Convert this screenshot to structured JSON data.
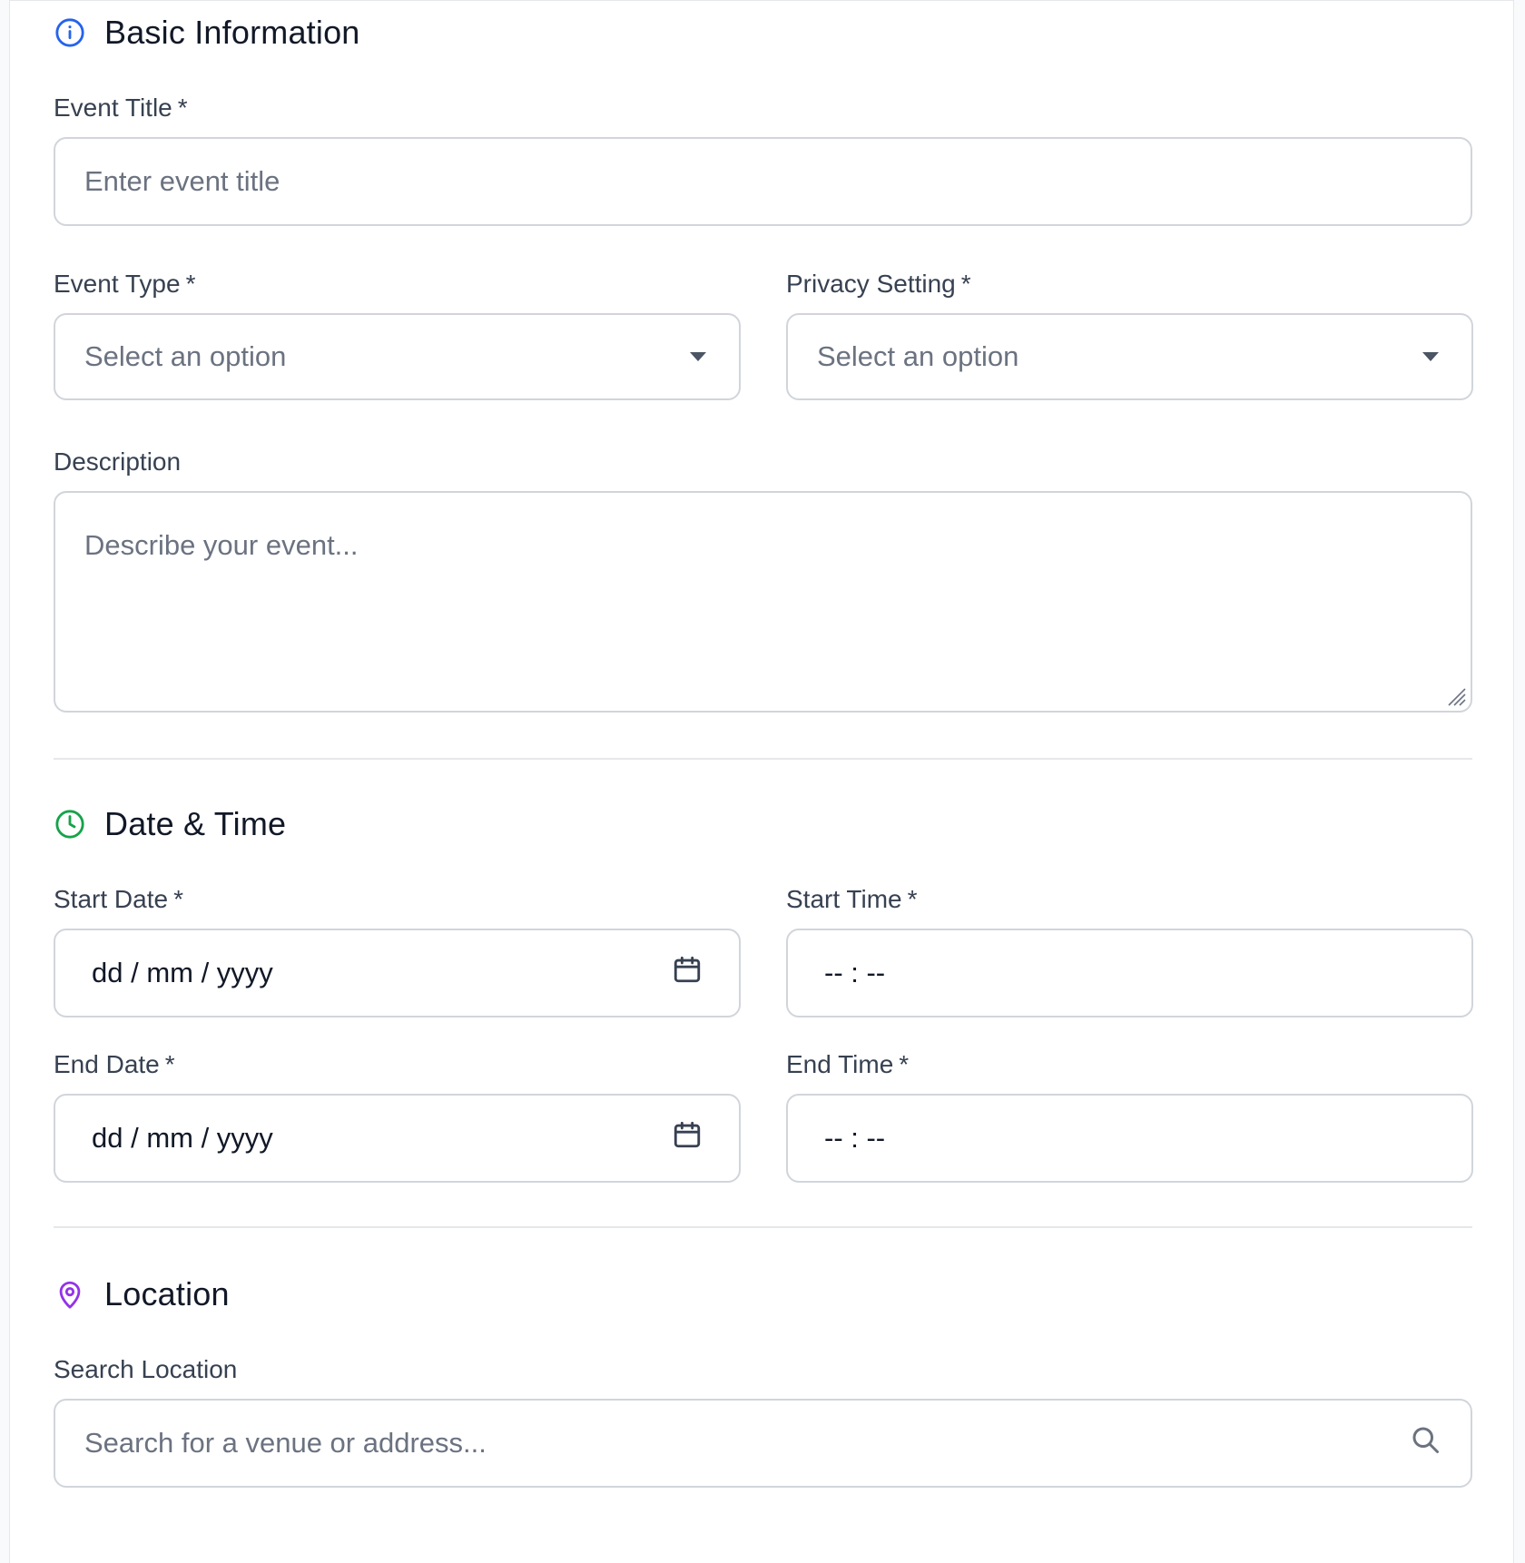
{
  "sections": {
    "basic": {
      "title": "Basic Information",
      "icon": "info-circle-icon",
      "color": "#2563eb",
      "fields": {
        "event_title": {
          "label": "Event Title",
          "required": "*",
          "placeholder": "Enter event title"
        },
        "event_type": {
          "label": "Event Type",
          "required": "*",
          "placeholder": "Select an option"
        },
        "privacy": {
          "label": "Privacy Setting",
          "required": "*",
          "placeholder": "Select an option"
        },
        "description": {
          "label": "Description",
          "placeholder": "Describe your event..."
        }
      }
    },
    "datetime": {
      "title": "Date & Time",
      "icon": "clock-icon",
      "color": "#16a34a",
      "fields": {
        "start_date": {
          "label": "Start Date",
          "required": "*",
          "value": "dd / mm / yyyy"
        },
        "start_time": {
          "label": "Start Time",
          "required": "*",
          "value": "-- : --"
        },
        "end_date": {
          "label": "End Date",
          "required": "*",
          "value": "dd / mm / yyyy"
        },
        "end_time": {
          "label": "End Time",
          "required": "*",
          "value": "-- : --"
        }
      }
    },
    "location": {
      "title": "Location",
      "icon": "map-pin-icon",
      "color": "#9333ea",
      "fields": {
        "search": {
          "label": "Search Location",
          "placeholder": "Search for a venue or address..."
        }
      }
    }
  }
}
